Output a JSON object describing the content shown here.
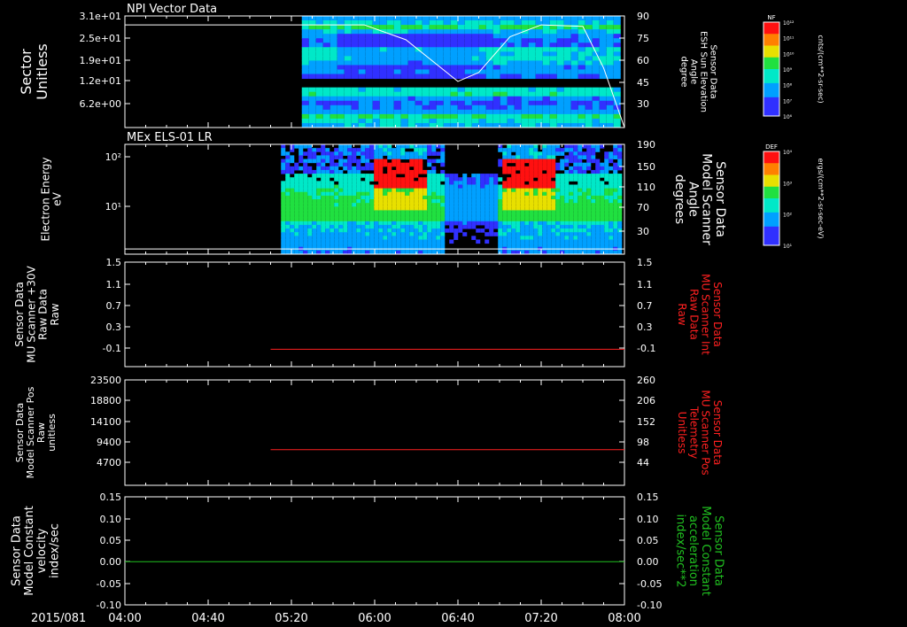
{
  "date_label": "2015/081",
  "time_ticks": [
    "04:00",
    "04:40",
    "05:20",
    "06:00",
    "06:40",
    "07:20",
    "08:00"
  ],
  "colors": {
    "background": "#000000",
    "axes": "#ffffff",
    "red_trace": "#ff2020",
    "green_trace": "#20c020"
  },
  "chart_data": [
    {
      "type": "heatmap",
      "title": "NPI Vector Data",
      "ylabel_lines": [
        "Sector",
        "Unitless"
      ],
      "ytick_labels": [
        "3.1e+01",
        "2.5e+01",
        "1.9e+01",
        "1.2e+01",
        "6.2e+00"
      ],
      "right_ylabel_lines": [
        "Sensor Data",
        "ESH Sun Elevation",
        "Angle",
        "degree"
      ],
      "right_ytick_labels": [
        "90",
        "75",
        "60",
        "45",
        "30"
      ],
      "right_ylim": [
        15,
        90
      ],
      "overlay_line": {
        "x": [
          "04:00",
          "05:15",
          "05:55",
          "06:15",
          "06:40",
          "06:50",
          "07:05",
          "07:20",
          "07:40",
          "07:50",
          "08:00"
        ],
        "y": [
          84,
          84,
          84,
          74,
          46,
          52,
          76,
          84,
          83,
          55,
          15
        ]
      },
      "colorbar": {
        "label": "NF",
        "ticks": [
          "10¹²",
          "10¹¹",
          "10¹⁰",
          "10⁹",
          "10⁸",
          "10⁷",
          "10⁶"
        ],
        "units": "cnts/(cm**2-sr-sec)"
      }
    },
    {
      "type": "heatmap",
      "title": "MEx ELS-01 LR",
      "ylabel_lines": [
        "Electron Energy",
        "eV"
      ],
      "ytick_labels": [
        "10²",
        "10¹"
      ],
      "yscale": "log",
      "right_ylabel_lines": [
        "Sensor Data",
        "Model Scanner",
        "Angle",
        "degrees"
      ],
      "right_ytick_labels": [
        "190",
        "150",
        "110",
        "70",
        "30"
      ],
      "right_ylim": [
        0,
        190
      ],
      "overlay_line": {
        "x": [
          "04:00",
          "08:00"
        ],
        "y": [
          9,
          9
        ]
      },
      "colorbar": {
        "label": "DEF",
        "ticks": [
          "10⁴",
          "10³",
          "10²",
          "10¹"
        ],
        "units": "ergs/(cm**2-sr-sec-eV)"
      }
    },
    {
      "type": "line",
      "ylabel_lines": [
        "Sensor Data",
        "MU Scanner +30V",
        "Raw Data",
        "Raw"
      ],
      "ytick_labels": [
        "1.5",
        "1.1",
        "0.7",
        "0.3",
        "-0.1"
      ],
      "ylim": [
        -0.3,
        1.5
      ],
      "right_ylabel_lines": [
        "Sensor Data",
        "MU Scanner Int",
        "Raw Data",
        "Raw"
      ],
      "right_ytick_labels": [
        "1.5",
        "1.1",
        "0.7",
        "0.3",
        "-0.1"
      ],
      "series": [
        {
          "x": [
            "05:10",
            "08:00"
          ],
          "y": [
            0.0,
            0.0
          ],
          "color": "red"
        }
      ]
    },
    {
      "type": "line",
      "ylabel_lines": [
        "Sensor Data",
        "Model Scanner Pos",
        "Raw",
        "unitless"
      ],
      "ytick_labels": [
        "23500",
        "18800",
        "14100",
        "9400",
        "4700"
      ],
      "ylim": [
        0,
        23500
      ],
      "right_ylabel_lines": [
        "Sensor Data",
        "MU Scanner Pos",
        "Telemetry",
        "Unitless"
      ],
      "right_ytick_labels": [
        "260",
        "206",
        "152",
        "98",
        "44"
      ],
      "right_ylim": [
        0,
        260
      ],
      "series": [
        {
          "x": [
            "05:10",
            "08:00"
          ],
          "y": [
            88,
            88
          ],
          "color": "red"
        }
      ]
    },
    {
      "type": "line",
      "ylabel_lines": [
        "Sensor Data",
        "Model Constant",
        "velocity",
        "index/sec"
      ],
      "ytick_labels": [
        "0.15",
        "0.10",
        "0.05",
        "0.00",
        "-0.05",
        "-0.10"
      ],
      "ylim": [
        -0.1,
        0.15
      ],
      "right_ylabel_lines": [
        "Sensor Data",
        "Model Constant",
        "acceleration",
        "index/sec**2"
      ],
      "right_ytick_labels": [
        "0.15",
        "0.10",
        "0.05",
        "0.00",
        "-0.05",
        "-0.10"
      ],
      "series": [
        {
          "x": [
            "04:00",
            "08:00"
          ],
          "y": [
            0.0,
            0.0
          ],
          "color": "green"
        }
      ]
    }
  ]
}
